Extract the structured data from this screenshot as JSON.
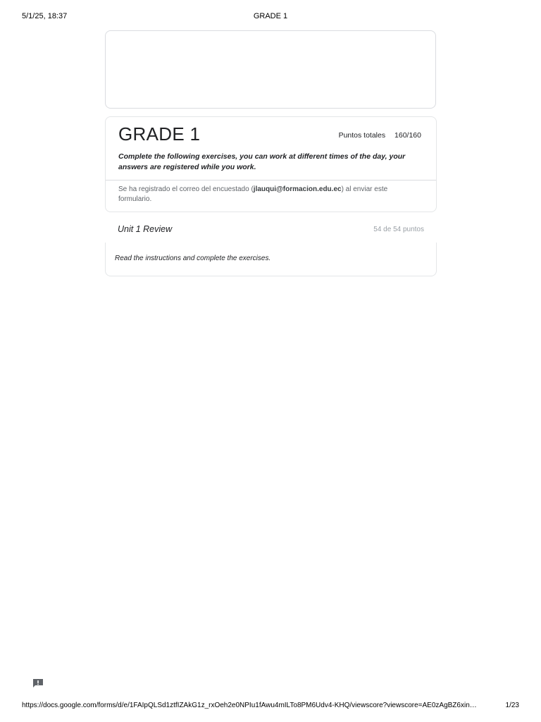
{
  "print_header": {
    "datetime": "5/1/25, 18:37",
    "title": "GRADE 1"
  },
  "form": {
    "title": "GRADE 1",
    "points_label": "Puntos totales",
    "points_value": "160/160",
    "description": "Complete the following exercises, you can work at different times of the day, your answers are registered while you work.",
    "email_notice_prefix": "Se ha registrado el correo del encuestado (",
    "email": "jlauqui@formacion.edu.ec",
    "email_notice_suffix": ") al enviar este formulario."
  },
  "section": {
    "title": "Unit 1 Review",
    "points": "54 de 54 puntos",
    "instructions": "Read the instructions and complete the exercises."
  },
  "feedback": {
    "icon": "feedback-icon",
    "color": "#5f6368"
  },
  "print_footer": {
    "url": "https://docs.google.com/forms/d/e/1FAIpQLSd1ztfIZAkG1z_rxOeh2e0NPIu1fAwu4mILTo8PM6Udv4-KHQ/viewscore?viewscore=AE0zAgBZ6xin…",
    "page": "1/23"
  }
}
